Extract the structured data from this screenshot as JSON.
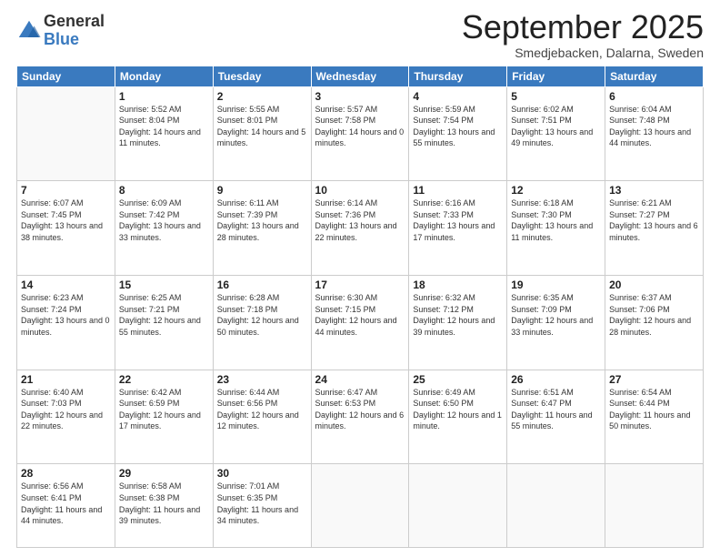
{
  "header": {
    "logo_general": "General",
    "logo_blue": "Blue",
    "month_title": "September 2025",
    "location": "Smedjebacken, Dalarna, Sweden"
  },
  "days_of_week": [
    "Sunday",
    "Monday",
    "Tuesday",
    "Wednesday",
    "Thursday",
    "Friday",
    "Saturday"
  ],
  "weeks": [
    [
      {
        "day": "",
        "sunrise": "",
        "sunset": "",
        "daylight": ""
      },
      {
        "day": "1",
        "sunrise": "Sunrise: 5:52 AM",
        "sunset": "Sunset: 8:04 PM",
        "daylight": "Daylight: 14 hours and 11 minutes."
      },
      {
        "day": "2",
        "sunrise": "Sunrise: 5:55 AM",
        "sunset": "Sunset: 8:01 PM",
        "daylight": "Daylight: 14 hours and 5 minutes."
      },
      {
        "day": "3",
        "sunrise": "Sunrise: 5:57 AM",
        "sunset": "Sunset: 7:58 PM",
        "daylight": "Daylight: 14 hours and 0 minutes."
      },
      {
        "day": "4",
        "sunrise": "Sunrise: 5:59 AM",
        "sunset": "Sunset: 7:54 PM",
        "daylight": "Daylight: 13 hours and 55 minutes."
      },
      {
        "day": "5",
        "sunrise": "Sunrise: 6:02 AM",
        "sunset": "Sunset: 7:51 PM",
        "daylight": "Daylight: 13 hours and 49 minutes."
      },
      {
        "day": "6",
        "sunrise": "Sunrise: 6:04 AM",
        "sunset": "Sunset: 7:48 PM",
        "daylight": "Daylight: 13 hours and 44 minutes."
      }
    ],
    [
      {
        "day": "7",
        "sunrise": "Sunrise: 6:07 AM",
        "sunset": "Sunset: 7:45 PM",
        "daylight": "Daylight: 13 hours and 38 minutes."
      },
      {
        "day": "8",
        "sunrise": "Sunrise: 6:09 AM",
        "sunset": "Sunset: 7:42 PM",
        "daylight": "Daylight: 13 hours and 33 minutes."
      },
      {
        "day": "9",
        "sunrise": "Sunrise: 6:11 AM",
        "sunset": "Sunset: 7:39 PM",
        "daylight": "Daylight: 13 hours and 28 minutes."
      },
      {
        "day": "10",
        "sunrise": "Sunrise: 6:14 AM",
        "sunset": "Sunset: 7:36 PM",
        "daylight": "Daylight: 13 hours and 22 minutes."
      },
      {
        "day": "11",
        "sunrise": "Sunrise: 6:16 AM",
        "sunset": "Sunset: 7:33 PM",
        "daylight": "Daylight: 13 hours and 17 minutes."
      },
      {
        "day": "12",
        "sunrise": "Sunrise: 6:18 AM",
        "sunset": "Sunset: 7:30 PM",
        "daylight": "Daylight: 13 hours and 11 minutes."
      },
      {
        "day": "13",
        "sunrise": "Sunrise: 6:21 AM",
        "sunset": "Sunset: 7:27 PM",
        "daylight": "Daylight: 13 hours and 6 minutes."
      }
    ],
    [
      {
        "day": "14",
        "sunrise": "Sunrise: 6:23 AM",
        "sunset": "Sunset: 7:24 PM",
        "daylight": "Daylight: 13 hours and 0 minutes."
      },
      {
        "day": "15",
        "sunrise": "Sunrise: 6:25 AM",
        "sunset": "Sunset: 7:21 PM",
        "daylight": "Daylight: 12 hours and 55 minutes."
      },
      {
        "day": "16",
        "sunrise": "Sunrise: 6:28 AM",
        "sunset": "Sunset: 7:18 PM",
        "daylight": "Daylight: 12 hours and 50 minutes."
      },
      {
        "day": "17",
        "sunrise": "Sunrise: 6:30 AM",
        "sunset": "Sunset: 7:15 PM",
        "daylight": "Daylight: 12 hours and 44 minutes."
      },
      {
        "day": "18",
        "sunrise": "Sunrise: 6:32 AM",
        "sunset": "Sunset: 7:12 PM",
        "daylight": "Daylight: 12 hours and 39 minutes."
      },
      {
        "day": "19",
        "sunrise": "Sunrise: 6:35 AM",
        "sunset": "Sunset: 7:09 PM",
        "daylight": "Daylight: 12 hours and 33 minutes."
      },
      {
        "day": "20",
        "sunrise": "Sunrise: 6:37 AM",
        "sunset": "Sunset: 7:06 PM",
        "daylight": "Daylight: 12 hours and 28 minutes."
      }
    ],
    [
      {
        "day": "21",
        "sunrise": "Sunrise: 6:40 AM",
        "sunset": "Sunset: 7:03 PM",
        "daylight": "Daylight: 12 hours and 22 minutes."
      },
      {
        "day": "22",
        "sunrise": "Sunrise: 6:42 AM",
        "sunset": "Sunset: 6:59 PM",
        "daylight": "Daylight: 12 hours and 17 minutes."
      },
      {
        "day": "23",
        "sunrise": "Sunrise: 6:44 AM",
        "sunset": "Sunset: 6:56 PM",
        "daylight": "Daylight: 12 hours and 12 minutes."
      },
      {
        "day": "24",
        "sunrise": "Sunrise: 6:47 AM",
        "sunset": "Sunset: 6:53 PM",
        "daylight": "Daylight: 12 hours and 6 minutes."
      },
      {
        "day": "25",
        "sunrise": "Sunrise: 6:49 AM",
        "sunset": "Sunset: 6:50 PM",
        "daylight": "Daylight: 12 hours and 1 minute."
      },
      {
        "day": "26",
        "sunrise": "Sunrise: 6:51 AM",
        "sunset": "Sunset: 6:47 PM",
        "daylight": "Daylight: 11 hours and 55 minutes."
      },
      {
        "day": "27",
        "sunrise": "Sunrise: 6:54 AM",
        "sunset": "Sunset: 6:44 PM",
        "daylight": "Daylight: 11 hours and 50 minutes."
      }
    ],
    [
      {
        "day": "28",
        "sunrise": "Sunrise: 6:56 AM",
        "sunset": "Sunset: 6:41 PM",
        "daylight": "Daylight: 11 hours and 44 minutes."
      },
      {
        "day": "29",
        "sunrise": "Sunrise: 6:58 AM",
        "sunset": "Sunset: 6:38 PM",
        "daylight": "Daylight: 11 hours and 39 minutes."
      },
      {
        "day": "30",
        "sunrise": "Sunrise: 7:01 AM",
        "sunset": "Sunset: 6:35 PM",
        "daylight": "Daylight: 11 hours and 34 minutes."
      },
      {
        "day": "",
        "sunrise": "",
        "sunset": "",
        "daylight": ""
      },
      {
        "day": "",
        "sunrise": "",
        "sunset": "",
        "daylight": ""
      },
      {
        "day": "",
        "sunrise": "",
        "sunset": "",
        "daylight": ""
      },
      {
        "day": "",
        "sunrise": "",
        "sunset": "",
        "daylight": ""
      }
    ]
  ]
}
